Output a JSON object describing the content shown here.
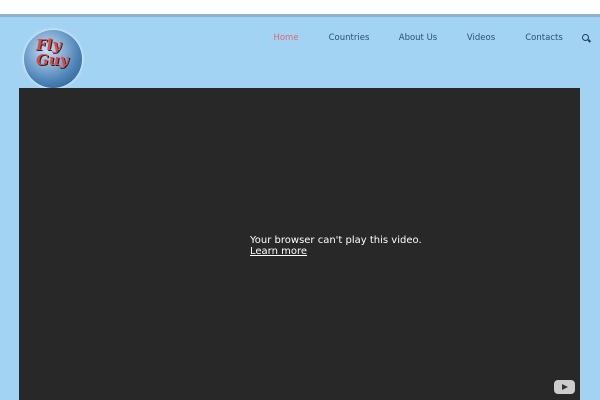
{
  "logo": {
    "text": "Fly Guy"
  },
  "nav": {
    "items": [
      {
        "label": "Home"
      },
      {
        "label": "Countries"
      },
      {
        "label": "About Us"
      },
      {
        "label": "Videos"
      },
      {
        "label": "Contacts"
      }
    ]
  },
  "video": {
    "message": "Your browser can't play this video.",
    "link": "Learn more"
  }
}
